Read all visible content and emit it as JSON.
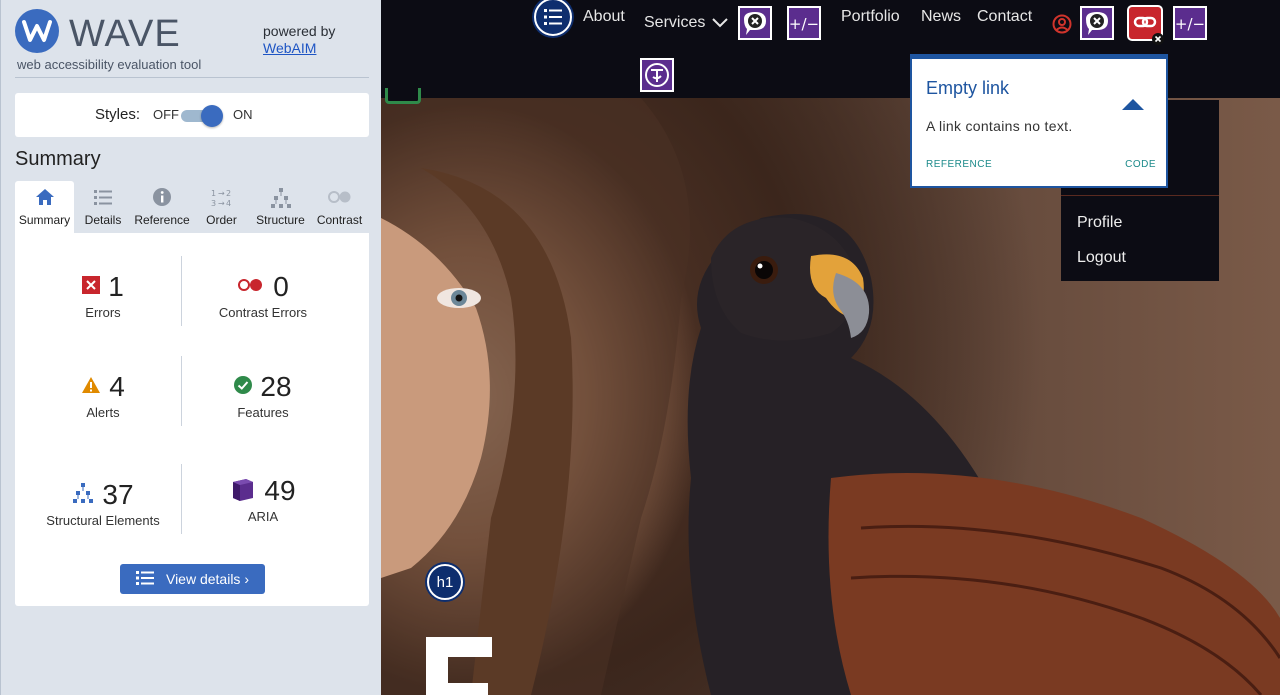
{
  "brand": {
    "name": "WAVE",
    "tagline": "web accessibility evaluation tool",
    "powered_by": "powered by",
    "webaim": "WebAIM"
  },
  "styles": {
    "label": "Styles:",
    "off": "OFF",
    "on": "ON",
    "state": "on"
  },
  "summary": {
    "heading": "Summary",
    "tabs": [
      {
        "label": "Summary",
        "icon": "home-icon",
        "active": true
      },
      {
        "label": "Details",
        "icon": "list-icon"
      },
      {
        "label": "Reference",
        "icon": "info-icon"
      },
      {
        "label": "Order",
        "icon": "order-icon"
      },
      {
        "label": "Structure",
        "icon": "structure-icon"
      },
      {
        "label": "Contrast",
        "icon": "contrast-icon"
      }
    ],
    "stats": {
      "errors": {
        "value": "1",
        "label": "Errors"
      },
      "contrast_errors": {
        "value": "0",
        "label": "Contrast Errors"
      },
      "alerts": {
        "value": "4",
        "label": "Alerts"
      },
      "features": {
        "value": "28",
        "label": "Features"
      },
      "structural": {
        "value": "37",
        "label": "Structural Elements"
      },
      "aria": {
        "value": "49",
        "label": "ARIA"
      }
    },
    "view_details": "View details ›"
  },
  "site": {
    "nav": {
      "about": "About",
      "services": "Services",
      "portfolio": "Portfolio",
      "news": "News",
      "contact": "Contact"
    },
    "dropdown": {
      "profile": "Profile",
      "logout": "Logout"
    },
    "tooltip": {
      "title": "Empty link",
      "body": "A link contains no text.",
      "reference": "REFERENCE",
      "code": "CODE"
    },
    "h1_badge": "h1"
  },
  "colors": {
    "wave_blue": "#3a6bbf",
    "error_red": "#c8262d",
    "aria_purple": "#5b2d8e",
    "feature_green": "#2f8a4a",
    "alert_orange": "#e08a00"
  }
}
